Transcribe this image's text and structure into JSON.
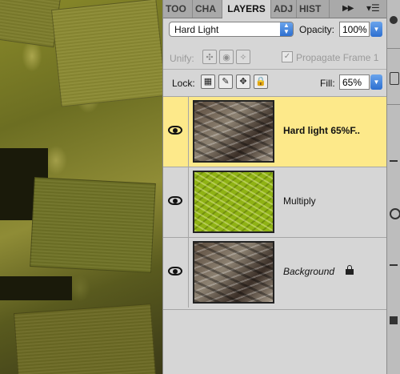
{
  "tabs": [
    {
      "label": "TOO",
      "active": false
    },
    {
      "label": "CHA",
      "active": false
    },
    {
      "label": "LAYERS",
      "active": true
    },
    {
      "label": "ADJ",
      "active": false
    },
    {
      "label": "HIST",
      "active": false
    }
  ],
  "tab_controls": {
    "expand_icon": "double-chevron-right-icon",
    "menu_icon": "panel-menu-icon"
  },
  "blend_mode": "Hard Light",
  "opacity": {
    "label": "Opacity:",
    "value": "100%"
  },
  "unify": {
    "label": "Unify:",
    "propagate_label": "Propagate Frame 1",
    "propagate_checked": true
  },
  "lock": {
    "label": "Lock:"
  },
  "fill": {
    "label": "Fill:",
    "value": "65%"
  },
  "layers": [
    {
      "name": "Hard light  65%F..",
      "selected": true,
      "visible": true,
      "thumbnail": "woodpile",
      "locked": false
    },
    {
      "name": "Multiply",
      "selected": false,
      "visible": true,
      "thumbnail": "green-texture",
      "locked": false
    },
    {
      "name": "Background",
      "selected": false,
      "visible": true,
      "thumbnail": "woodpile",
      "locked": true
    }
  ],
  "colors": {
    "selected_layer": "#fde98a",
    "panel_bg": "#d6d6d6",
    "accent_blue": "#2d6fd0"
  }
}
